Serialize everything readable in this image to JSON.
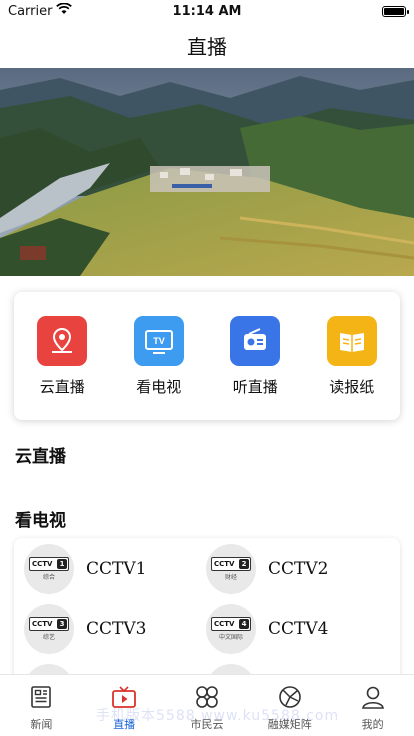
{
  "status_bar": {
    "carrier": "Carrier",
    "time": "11:14 AM"
  },
  "nav": {
    "title": "直播"
  },
  "quick_actions": [
    {
      "label": "云直播",
      "icon": "location-pin-icon",
      "color": "#e8433f"
    },
    {
      "label": "看电视",
      "icon": "tv-icon",
      "color": "#3d9bf0"
    },
    {
      "label": "听直播",
      "icon": "radio-icon",
      "color": "#3a75e8"
    },
    {
      "label": "读报纸",
      "icon": "newspaper-icon",
      "color": "#f5b416"
    }
  ],
  "sections": {
    "cloud_live": "云直播",
    "watch_tv": "看电视"
  },
  "channels": [
    {
      "name": "CCTV1",
      "logo_num": "1",
      "logo_sub": "综合"
    },
    {
      "name": "CCTV2",
      "logo_num": "2",
      "logo_sub": "财经"
    },
    {
      "name": "CCTV3",
      "logo_num": "3",
      "logo_sub": "综艺"
    },
    {
      "name": "CCTV4",
      "logo_num": "4",
      "logo_sub": "中文国际"
    }
  ],
  "tabs": [
    {
      "label": "新闻",
      "icon": "news-icon"
    },
    {
      "label": "直播",
      "icon": "live-tv-icon",
      "active": true
    },
    {
      "label": "市民云",
      "icon": "clover-icon"
    },
    {
      "label": "融媒矩阵",
      "icon": "media-matrix-icon"
    },
    {
      "label": "我的",
      "icon": "profile-icon"
    }
  ],
  "watermark": "手机版本5588 www.ku5588.com",
  "colors": {
    "accent": "#1a63d8",
    "active_tab": "#d9342b"
  }
}
